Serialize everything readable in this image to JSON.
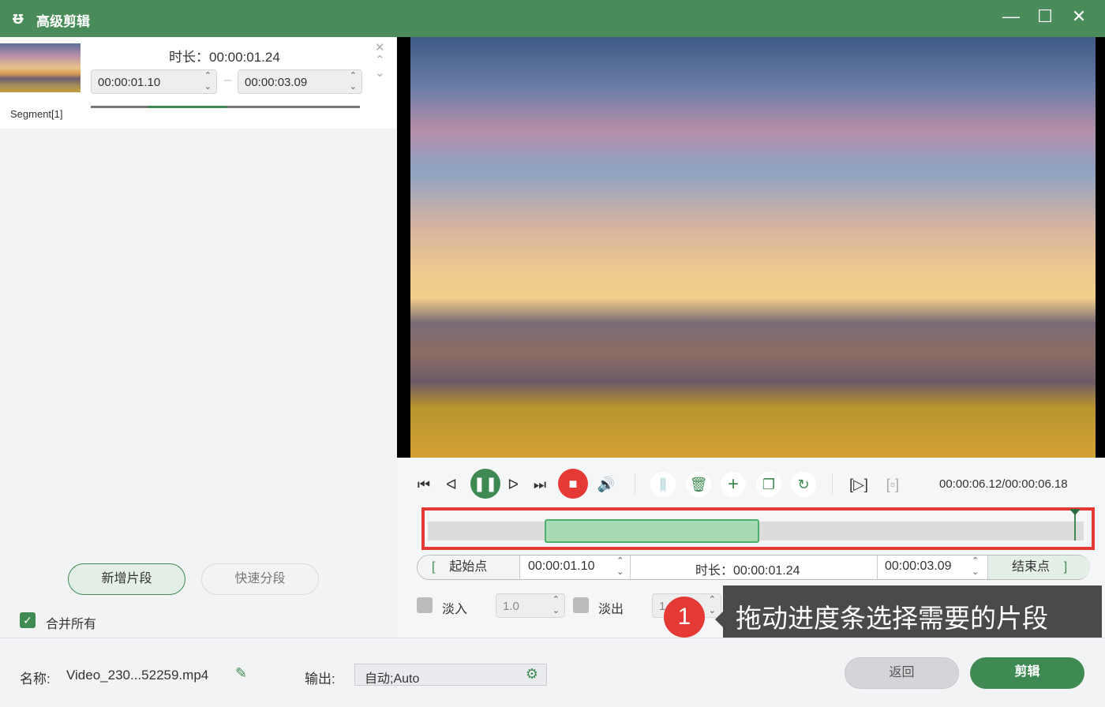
{
  "title": "高级剪辑",
  "segment": {
    "duration_label": "时长：00:00:01.24",
    "start": "00:00:01.10",
    "end": "00:00:03.09",
    "name": "Segment[1]",
    "separator": "–"
  },
  "left": {
    "add_segment": "新增片段",
    "quick_split": "快速分段",
    "merge_all": "合并所有"
  },
  "player": {
    "time": "00:00:06.12/00:00:06.18",
    "progress": 0.986,
    "selection_start": 0.178,
    "selection_end": 0.505
  },
  "range": {
    "start_label": "起始点",
    "start": "00:00:01.10",
    "duration": "时长：00:00:01.24",
    "end": "00:00:03.09",
    "end_label": "结束点"
  },
  "fade": {
    "in_label": "淡入",
    "in_value": "1.0",
    "out_label": "淡出",
    "out_value": "1"
  },
  "callout": {
    "number": "1",
    "text": "拖动进度条选择需要的片段"
  },
  "bottom": {
    "name_label": "名称:",
    "name_value": "Video_230...52259.mp4",
    "output_label": "输出:",
    "output_value": "自动;Auto",
    "back": "返回",
    "clip": "剪辑"
  },
  "colors": {
    "accent": "#3f8a53",
    "titlebar": "#4a8c59",
    "record": "#e53935",
    "highlight": "#e53935"
  }
}
